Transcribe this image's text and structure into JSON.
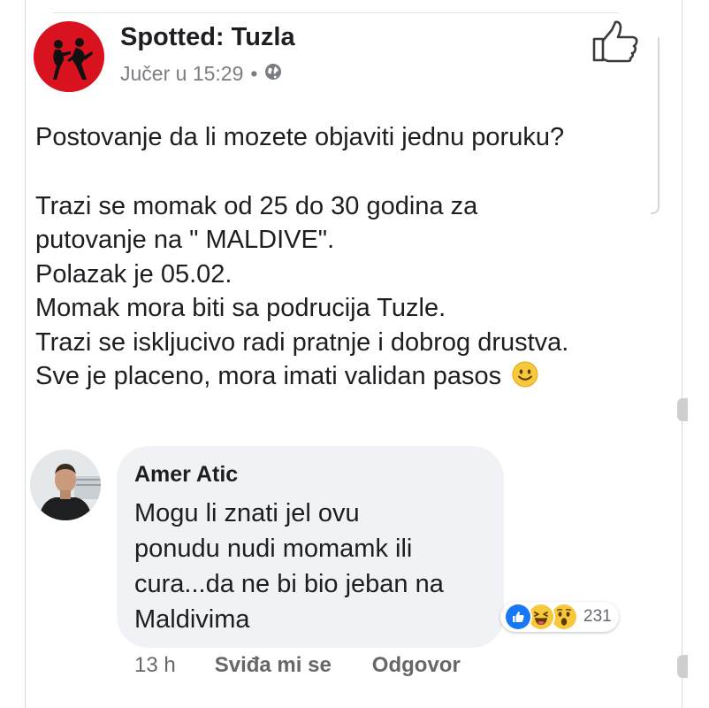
{
  "post": {
    "page_name": "Spotted: Tuzla",
    "timestamp": "Jučer u 15:29",
    "separator": "•",
    "privacy_icon": "globe-icon",
    "action_icon": "thumbs-up-outline-icon",
    "body_lines": [
      "Postovanje da li mozete objaviti jednu poruku?",
      "",
      "Trazi se momak od 25 do 30 godina za",
      "putovanje na \" MALDIVE\".",
      "Polazak je 05.02.",
      "Momak mora biti sa podrucija Tuzle.",
      "Trazi se iskljucivo radi pratnje i dobrog drustva.",
      "Sve je placeno, mora imati validan pasos"
    ],
    "body_emoji": "slightly-smiling-face"
  },
  "comment": {
    "author": "Amer Atic",
    "text_lines": [
      "Mogu li znati jel ovu",
      "ponudu nudi momamk ili",
      "cura...da ne bi bio jeban na",
      "Maldivima"
    ],
    "reactions": {
      "icons": [
        "like-reaction-icon",
        "haha-reaction-icon",
        "wow-reaction-icon"
      ],
      "count": "231"
    },
    "time": "13 h",
    "like_label": "Sviđa mi se",
    "reply_label": "Odgovor"
  },
  "colors": {
    "text": "#1c1e21",
    "meta": "#7a7d82",
    "bubble": "#f0f2f5",
    "avatar_bg": "#d8121e",
    "like_blue": "#1877f2",
    "emoji_yellow": "#f7c83b"
  }
}
